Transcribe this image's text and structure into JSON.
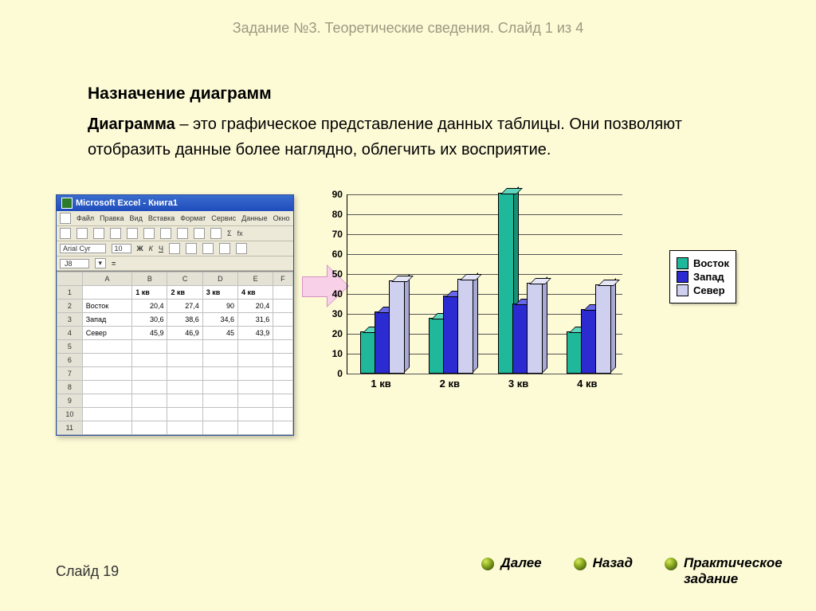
{
  "header": "Задание №3. Теоретические сведения. Слайд 1 из 4",
  "title": "Назначение диаграмм",
  "para_bold": "Диаграмма",
  "para_rest": " – это графическое представление данных таблицы. Они позволяют отобразить данные более наглядно,  облегчить их восприятие.",
  "excel": {
    "title": "Microsoft Excel - Книга1",
    "menus": [
      "Файл",
      "Правка",
      "Вид",
      "Вставка",
      "Формат",
      "Сервис",
      "Данные",
      "Окно"
    ],
    "font": "Arial Cyr",
    "size": "10",
    "cellref": "J8",
    "cols": [
      "A",
      "B",
      "C",
      "D",
      "E",
      "F"
    ],
    "row_hdr": [
      "",
      "1 кв",
      "2 кв",
      "3 кв",
      "4 кв"
    ],
    "rows": [
      [
        "Восток",
        "20,4",
        "27,4",
        "90",
        "20,4"
      ],
      [
        "Запад",
        "30,6",
        "38,6",
        "34,6",
        "31,6"
      ],
      [
        "Север",
        "45,9",
        "46,9",
        "45",
        "43,9"
      ]
    ]
  },
  "chart_data": {
    "type": "bar",
    "categories": [
      "1 кв",
      "2 кв",
      "3 кв",
      "4 кв"
    ],
    "series": [
      {
        "name": "Восток",
        "values": [
          20.4,
          27.4,
          90,
          20.4
        ],
        "color": "#1fb89a"
      },
      {
        "name": "Запад",
        "values": [
          30.6,
          38.6,
          34.6,
          31.6
        ],
        "color": "#2b2bd1"
      },
      {
        "name": "Север",
        "values": [
          45.9,
          46.9,
          45,
          43.9
        ],
        "color": "#cfcff0"
      }
    ],
    "ylim": [
      0,
      90
    ],
    "yticks": [
      0,
      10,
      20,
      30,
      40,
      50,
      60,
      70,
      80,
      90
    ]
  },
  "legend": [
    "Восток",
    "Запад",
    "Север"
  ],
  "footer": {
    "slide": "Слайд 19",
    "next": "Далее",
    "back": "Назад",
    "task": "Практическое задание"
  }
}
